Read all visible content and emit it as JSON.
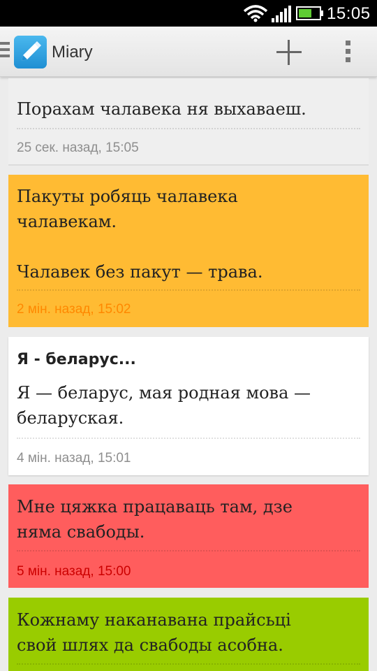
{
  "status_bar": {
    "time": "15:05"
  },
  "action_bar": {
    "title": "Miary"
  },
  "notes": [
    {
      "title": "",
      "text": [
        "Порахам чалавека ня выхаваеш."
      ],
      "time": "25 сек. назад, 15:05",
      "color": "#efefef",
      "time_color": "#8e8e8e"
    },
    {
      "title": "",
      "text": [
        "Пакуты робяць чалавека",
        "чалавекам.",
        "",
        "Чалавек без пакут — трава."
      ],
      "time": "2 мін. назад, 15:02",
      "color": "#ffbb33",
      "time_color": "#ff8800"
    },
    {
      "title": "Я - беларус...",
      "text": [
        "Я — беларус, мая родная мова —",
        "беларуская."
      ],
      "time": "4 мін. назад, 15:01",
      "color": "#ffffff",
      "time_color": "#8e8e8e"
    },
    {
      "title": "",
      "text": [
        "Мне цяжка працаваць там, дзе",
        "няма свабоды."
      ],
      "time": "5 мін. назад, 15:00",
      "color": "#ff5d5d",
      "time_color": "#cc0000"
    },
    {
      "title": "",
      "text": [
        "Кожнаму наканавана прайсьці",
        "свой шлях да свабоды асобна."
      ],
      "time": "",
      "color": "#99cc00",
      "time_color": "#669900"
    }
  ]
}
